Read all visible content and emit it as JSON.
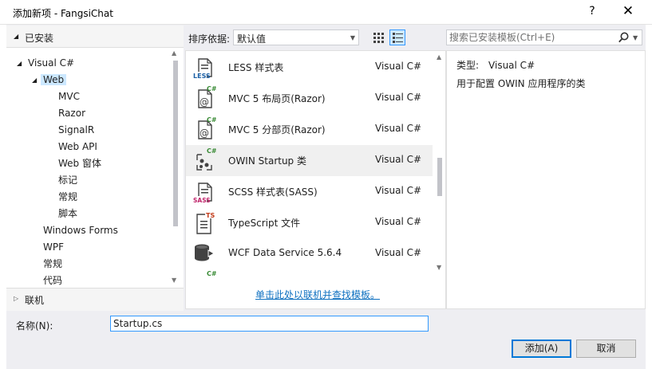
{
  "window": {
    "title": "添加新项 - FangsiChat",
    "help_label": "?",
    "close_label": "✕"
  },
  "left_pane": {
    "installed_label": "已安装",
    "tree": [
      {
        "label": "Visual C#",
        "level": 0,
        "expanded": true
      },
      {
        "label": "Web",
        "level": 1,
        "expanded": true,
        "selected": true
      },
      {
        "label": "MVC",
        "level": 2
      },
      {
        "label": "Razor",
        "level": 2
      },
      {
        "label": "SignalR",
        "level": 2
      },
      {
        "label": "Web API",
        "level": 2
      },
      {
        "label": "Web 窗体",
        "level": 2
      },
      {
        "label": "标记",
        "level": 2
      },
      {
        "label": "常规",
        "level": 2
      },
      {
        "label": "脚本",
        "level": 2
      },
      {
        "label": "Windows Forms",
        "level": 1
      },
      {
        "label": "WPF",
        "level": 1
      },
      {
        "label": "常规",
        "level": 1
      },
      {
        "label": "代码",
        "level": 1
      }
    ],
    "online_label": "联机"
  },
  "toolbar": {
    "sort_label": "排序依据:",
    "sort_value": "默认值",
    "view_mode": "list"
  },
  "search": {
    "placeholder": "搜索已安装模板(Ctrl+E)"
  },
  "templates": [
    {
      "name": "LESS 样式表",
      "lang": "Visual C#",
      "icon": "less-file-icon"
    },
    {
      "name": "MVC 5 布局页(Razor)",
      "lang": "Visual C#",
      "icon": "razor-layout-icon"
    },
    {
      "name": "MVC 5 分部页(Razor)",
      "lang": "Visual C#",
      "icon": "razor-partial-icon"
    },
    {
      "name": "OWIN Startup 类",
      "lang": "Visual C#",
      "icon": "owin-startup-icon",
      "selected": true
    },
    {
      "name": "SCSS 样式表(SASS)",
      "lang": "Visual C#",
      "icon": "scss-file-icon"
    },
    {
      "name": "TypeScript 文件",
      "lang": "Visual C#",
      "icon": "typescript-file-icon"
    },
    {
      "name": "WCF Data Service 5.6.4",
      "lang": "Visual C#",
      "icon": "wcf-data-service-icon"
    }
  ],
  "online_link": "单击此处以联机并查找模板。",
  "details": {
    "type_label": "类型:",
    "type_value": "Visual C#",
    "description": "用于配置 OWIN 应用程序的类"
  },
  "name_field": {
    "label": "名称(N):",
    "value": "Startup.cs"
  },
  "buttons": {
    "add": "添加(A)",
    "cancel": "取消"
  },
  "colors": {
    "dialog_bg": "#eeeef2",
    "selection": "#cce8ff",
    "accent": "#0078d7",
    "link": "#0e70c0",
    "csharp_green": "#388a34"
  }
}
